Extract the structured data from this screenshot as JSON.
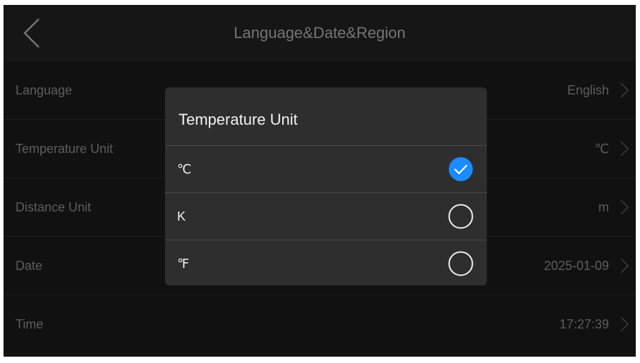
{
  "header": {
    "title": "Language&Date&Region",
    "back_icon": "chevron-left-icon"
  },
  "settings": [
    {
      "label": "Language",
      "value": "English"
    },
    {
      "label": "Temperature Unit",
      "value": "℃"
    },
    {
      "label": "Distance Unit",
      "value": "m"
    },
    {
      "label": "Date",
      "value": "2025-01-09"
    },
    {
      "label": "Time",
      "value": "17:27:39"
    }
  ],
  "dialog": {
    "title": "Temperature Unit",
    "options": [
      {
        "label": "℃",
        "selected": true
      },
      {
        "label": "K",
        "selected": false
      },
      {
        "label": "℉",
        "selected": false
      }
    ]
  },
  "colors": {
    "background": "#141414",
    "dialog": "#2e2e2e",
    "accent": "#1a8cff",
    "muted_text": "#6e6e6e"
  }
}
